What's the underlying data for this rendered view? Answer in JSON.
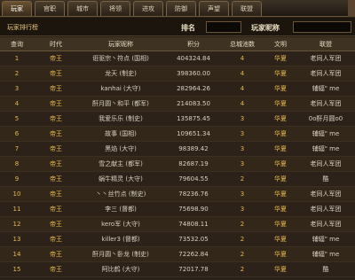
{
  "tabs": [
    "玩家",
    "官职",
    "城市",
    "将领",
    "进攻",
    "防御",
    "声望",
    "联盟"
  ],
  "active_tab": 0,
  "title": "玩家排行榜",
  "filter_label_1": "排名",
  "filter_label_2": "玩家昵称",
  "columns": [
    "查询",
    "时代",
    "玩家昵称",
    "积分",
    "总城池数",
    "文明",
    "联盟"
  ],
  "rows": [
    {
      "rank": "1",
      "era": "帝王",
      "name": "诳驱宗丶符点 (国相)",
      "score": "404324.84",
      "cities": "4",
      "civ": "华夏",
      "alliance": "老同人军团"
    },
    {
      "rank": "2",
      "era": "帝王",
      "name": "龙天 (制史)",
      "score": "398360.00",
      "cities": "4",
      "civ": "华夏",
      "alliance": "老同人军团"
    },
    {
      "rank": "3",
      "era": "帝王",
      "name": "kanhai (大守)",
      "score": "282964.26",
      "cities": "4",
      "civ": "华夏",
      "alliance": "辅辐\" me"
    },
    {
      "rank": "4",
      "era": "帝王",
      "name": "酐月圆丶和平 (都军)",
      "score": "214083.50",
      "cities": "4",
      "civ": "华夏",
      "alliance": "老同人军团"
    },
    {
      "rank": "5",
      "era": "帝王",
      "name": "我爱乐乐 (制史)",
      "score": "135875.45",
      "cities": "3",
      "civ": "华夏",
      "alliance": "0o酐月圆o0"
    },
    {
      "rank": "6",
      "era": "帝王",
      "name": "故事 (国相)",
      "score": "109651.34",
      "cities": "3",
      "civ": "华夏",
      "alliance": "辅辐\" me"
    },
    {
      "rank": "7",
      "era": "帝王",
      "name": "黑焰 (大守)",
      "score": "98389.42",
      "cities": "3",
      "civ": "华夏",
      "alliance": "辅辐\" me"
    },
    {
      "rank": "8",
      "era": "帝王",
      "name": "雪之献主 (都军)",
      "score": "82687.19",
      "cities": "3",
      "civ": "华夏",
      "alliance": "老同人军团"
    },
    {
      "rank": "9",
      "era": "帝王",
      "name": "蜗牛精灵 (大守)",
      "score": "79604.55",
      "cities": "2",
      "civ": "华夏",
      "alliance": "酷"
    },
    {
      "rank": "10",
      "era": "帝王",
      "name": "丶丶丝竹点 (制史)",
      "score": "78236.76",
      "cities": "3",
      "civ": "华夏",
      "alliance": "老同人军团"
    },
    {
      "rank": "11",
      "era": "帝王",
      "name": "李三 (督都)",
      "score": "75698.90",
      "cities": "3",
      "civ": "华夏",
      "alliance": "老同人军团"
    },
    {
      "rank": "12",
      "era": "帝王",
      "name": "kero军 (大守)",
      "score": "74808.11",
      "cities": "2",
      "civ": "华夏",
      "alliance": "老同人军团"
    },
    {
      "rank": "13",
      "era": "帝王",
      "name": "killer3 (督都)",
      "score": "73532.05",
      "cities": "2",
      "civ": "华夏",
      "alliance": "辅辐\" me"
    },
    {
      "rank": "14",
      "era": "帝王",
      "name": "酐月圆丶卧龙 (制史)",
      "score": "72262.84",
      "cities": "2",
      "civ": "华夏",
      "alliance": "辅辐\" me"
    },
    {
      "rank": "15",
      "era": "帝王",
      "name": "阿比鹤 (大守)",
      "score": "72017.78",
      "cities": "2",
      "civ": "华夏",
      "alliance": "酷"
    }
  ]
}
